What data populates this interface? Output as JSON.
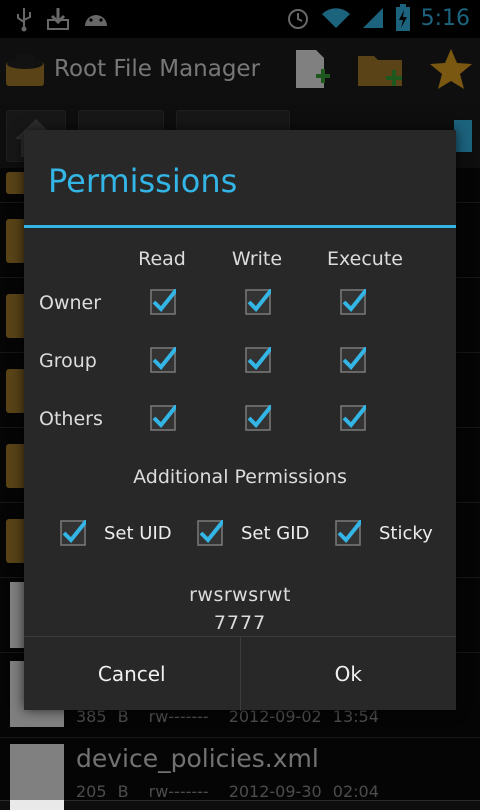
{
  "status_bar": {
    "time": "5:16",
    "icons": [
      "usb-icon",
      "download-icon",
      "android-icon",
      "alarm-icon",
      "wifi-icon",
      "signal-icon",
      "battery-charging-icon"
    ]
  },
  "action_bar": {
    "title": "Root File Manager",
    "actions": [
      "new-file-icon",
      "new-folder-icon",
      "bookmark-star-icon"
    ]
  },
  "background_files": [
    {
      "name": "device_policies.xml",
      "size": "205 B",
      "perms": "rw-------",
      "date": "2012-09-30 02:04"
    },
    {
      "name": "",
      "size": "385 B",
      "perms": "rw-------",
      "date": "2012-09-02 13:54"
    }
  ],
  "dialog": {
    "title": "Permissions",
    "columns": [
      "Read",
      "Write",
      "Execute"
    ],
    "rows": [
      {
        "label": "Owner",
        "read": true,
        "write": true,
        "execute": true
      },
      {
        "label": "Group",
        "read": true,
        "write": true,
        "execute": true
      },
      {
        "label": "Others",
        "read": true,
        "write": true,
        "execute": true
      }
    ],
    "additional_title": "Additional Permissions",
    "special": [
      {
        "label": "Set UID",
        "checked": true
      },
      {
        "label": "Set GID",
        "checked": true
      },
      {
        "label": "Sticky",
        "checked": true
      }
    ],
    "symbolic": "rwsrwsrwt",
    "octal": "7777",
    "cancel_label": "Cancel",
    "ok_label": "Ok"
  },
  "colors": {
    "accent": "#33b5e5",
    "dialog_bg": "#282828",
    "folder": "#a27a2a"
  }
}
